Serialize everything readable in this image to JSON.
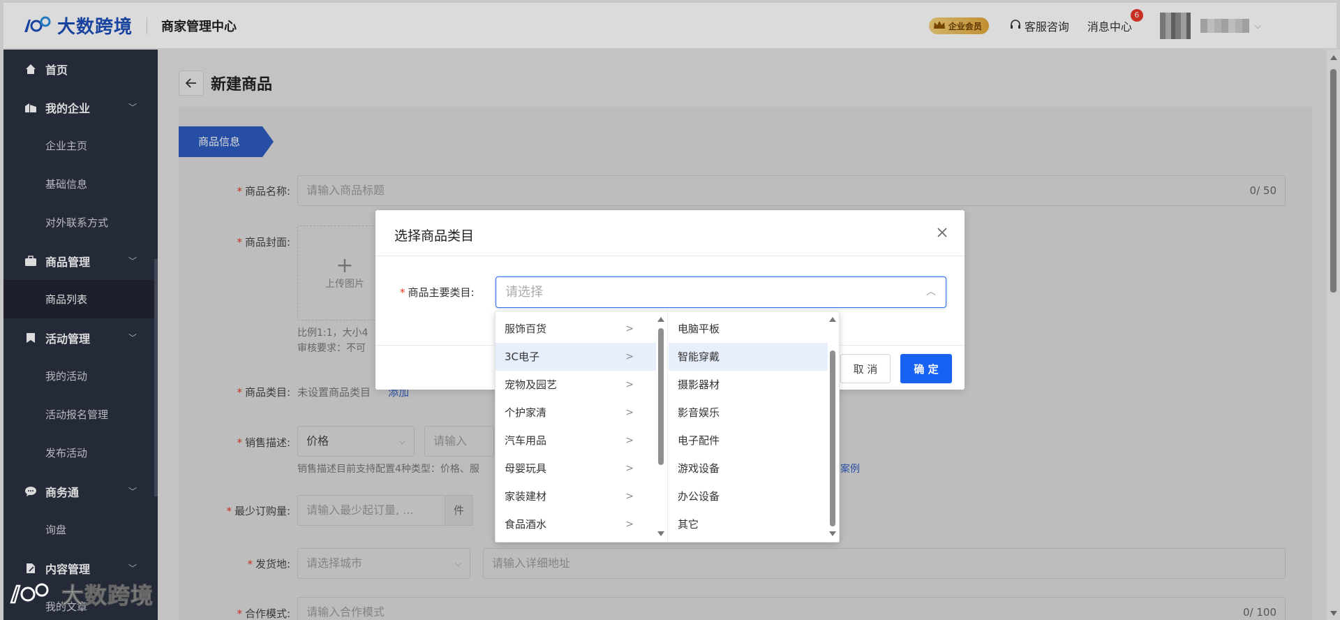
{
  "header": {
    "logo_text": "大数跨境",
    "subtitle": "商家管理中心",
    "vip_badge": "企业会员",
    "service": "客服咨询",
    "messages": "消息中心",
    "message_count": "6"
  },
  "sidebar": {
    "items": [
      {
        "label": "首页",
        "icon": "home-icon"
      },
      {
        "label": "我的企业",
        "icon": "company-icon"
      },
      {
        "label": "企业主页"
      },
      {
        "label": "基础信息"
      },
      {
        "label": "对外联系方式"
      },
      {
        "label": "商品管理",
        "icon": "briefcase-icon"
      },
      {
        "label": "商品列表"
      },
      {
        "label": "活动管理",
        "icon": "bookmark-icon"
      },
      {
        "label": "我的活动"
      },
      {
        "label": "活动报名管理"
      },
      {
        "label": "发布活动"
      },
      {
        "label": "商务通",
        "icon": "chat-icon"
      },
      {
        "label": "询盘"
      },
      {
        "label": "内容管理",
        "icon": "edit-icon"
      },
      {
        "label": "我的文章"
      }
    ]
  },
  "page": {
    "title": "新建商品",
    "step_tab": "商品信息"
  },
  "form": {
    "name_label": "商品名称:",
    "name_placeholder": "请输入商品标题",
    "name_count": "0/ 50",
    "cover_label": "商品封面:",
    "upload_label": "上传图片",
    "cover_hint1": "比例1:1，大小4",
    "cover_hint2": "审核要求：不可",
    "category_label": "商品类目:",
    "category_value": "未设置商品类目",
    "category_add": "添加",
    "sales_label": "销售描述:",
    "sales_type": "价格",
    "sales_placeholder": "请输入",
    "sales_hint": "销售描述目前支持配置4种类型：价格、服",
    "sales_example": "案例",
    "moq_label": "最少订购量:",
    "moq_placeholder": "请输入最少起订量, ...",
    "moq_unit": "件",
    "ship_label": "发货地:",
    "ship_city": "请选择城市",
    "ship_address": "请输入详细地址",
    "coop_label": "合作模式:",
    "coop_placeholder": "请输入合作模式",
    "coop_count": "0/ 100"
  },
  "dialog": {
    "title": "选择商品类目",
    "field_label": "商品主要类目:",
    "placeholder": "请选择",
    "cancel": "取 消",
    "confirm": "确 定"
  },
  "cascade": {
    "level1": [
      "服饰百货",
      "3C电子",
      "宠物及园艺",
      "个护家清",
      "汽车用品",
      "母婴玩具",
      "家装建材",
      "食品酒水"
    ],
    "level1_selected": "3C电子",
    "level2": [
      "电脑平板",
      "智能穿戴",
      "摄影器材",
      "影音娱乐",
      "电子配件",
      "游戏设备",
      "办公设备",
      "其它"
    ],
    "level2_hover": "智能穿戴"
  },
  "watermark": "大数跨境",
  "colors": {
    "primary": "#1762f2",
    "sidebar_bg": "#2c3142",
    "required": "#e83828"
  }
}
